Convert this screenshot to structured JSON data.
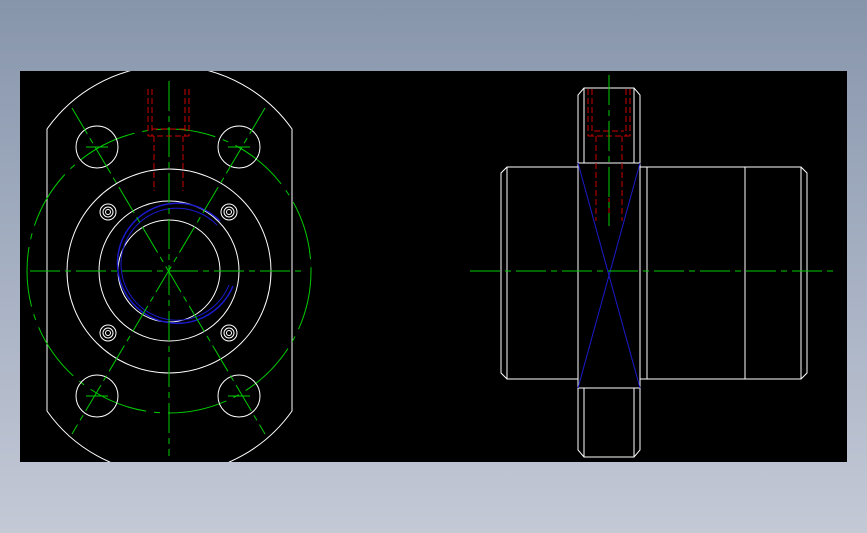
{
  "viewer": {
    "background_top": "#8795ab",
    "background_bottom": "#c4c9d6",
    "canvas_background": "#000000"
  },
  "drawing": {
    "type": "ball screw nut flange, two orthographic views",
    "views": [
      "front-view",
      "side-view"
    ],
    "line_colors": {
      "outline": "#ffffff",
      "centerline": "#00cc00",
      "hidden_thread": "#cc0000",
      "pitch_arc": "#1a1acc"
    },
    "labels": []
  }
}
